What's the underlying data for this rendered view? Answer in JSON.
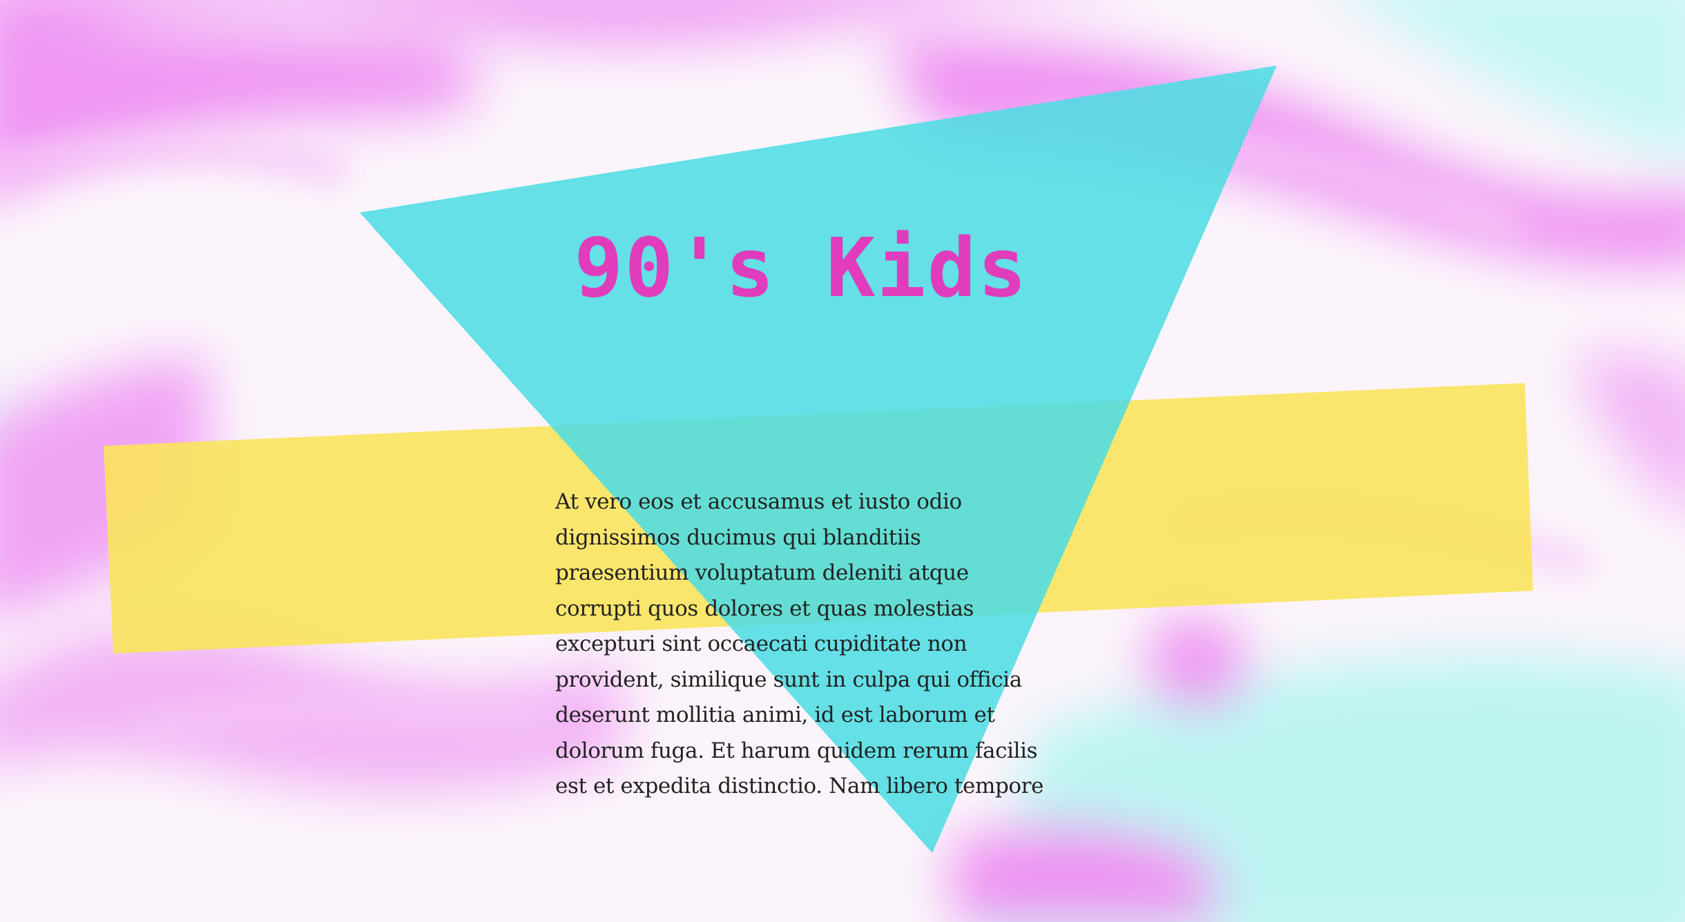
{
  "hero": {
    "title": "90's Kids",
    "paragraph": "At vero eos et accusamus et iusto odio dignissimos ducimus qui blanditiis praesentium voluptatum deleniti atque corrupti quos dolores et quas molestias excepturi sint occaecati cupiditate non provident, similique sunt in culpa qui officia deserunt mollitia animi, id est laborum et dolorum fuga. Et harum quidem rerum facilis est et expedita distinctio. Nam libero tempore"
  },
  "colors": {
    "title": "#e03cbb",
    "text": "#222222",
    "triangle": "#4fdde3",
    "band": "#f9e45c",
    "swirl_pink": "#ee8cf2",
    "swirl_cyan": "#b4f8f4",
    "background": "#fbf5fb"
  }
}
